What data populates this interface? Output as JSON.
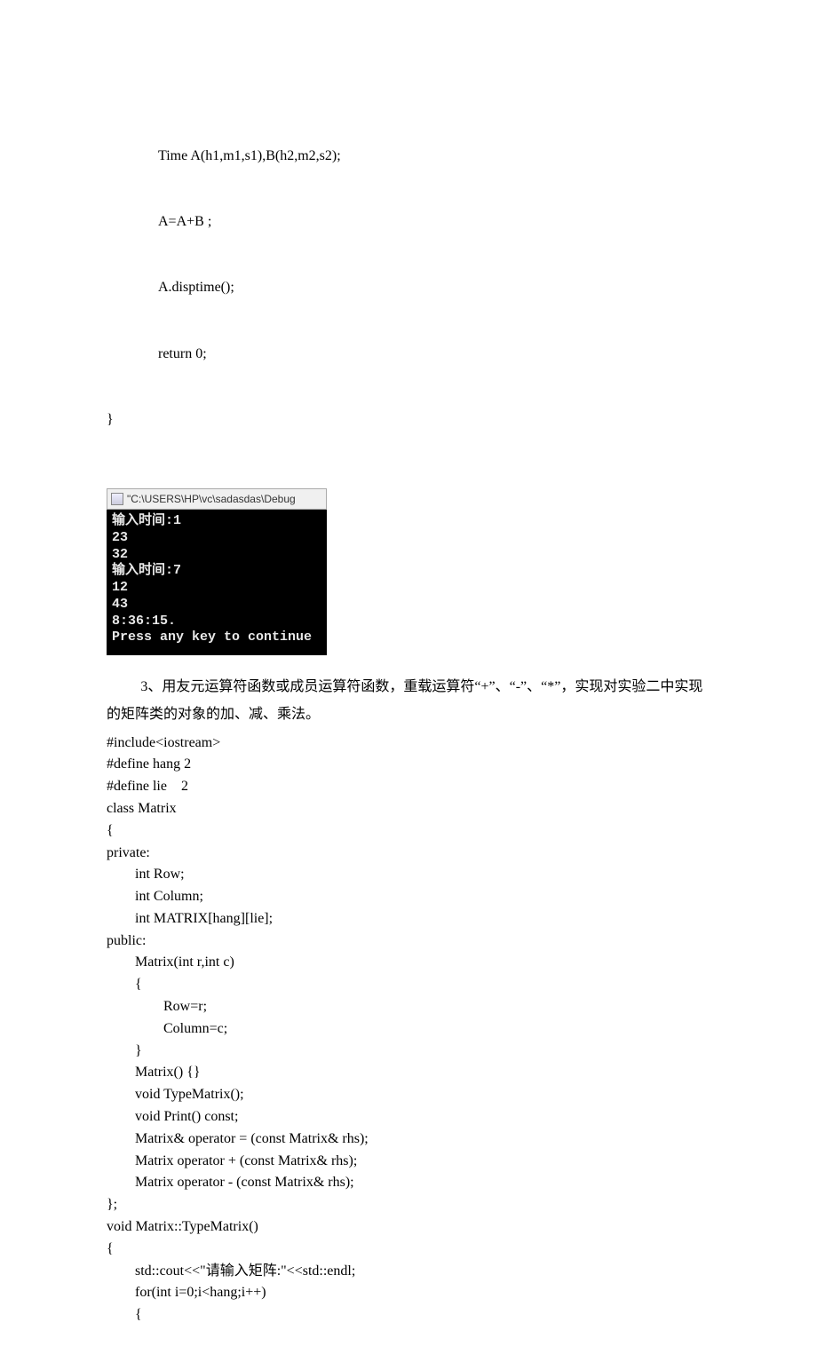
{
  "code_top": {
    "l1": "Time A(h1,m1,s1),B(h2,m2,s2);",
    "l2": "A=A+B ;",
    "l3": "A.disptime();",
    "l4": "return 0;",
    "l5": "}"
  },
  "console": {
    "title_prefix": "\"C:\\USERS\\HP\\vc\\sadasdas\\Debug",
    "line1": "输入时间:1",
    "line2": "23",
    "line3": "32",
    "line4": "输入时间:7",
    "line5": "12",
    "line6": "43",
    "line7": "8:36:15.",
    "line8": "Press any key to continue"
  },
  "paragraph": "3、用友元运算符函数或成员运算符函数，重载运算符“+”、“-”、“*”，实现对实验二中实现的矩阵类的对象的加、减、乘法。",
  "code_main": "#include<iostream>\n#define hang 2\n#define lie    2\nclass Matrix\n{\nprivate:\n        int Row;\n        int Column;\n        int MATRIX[hang][lie];\npublic:\n        Matrix(int r,int c)\n        {\n                Row=r;\n                Column=c;\n        }\n        Matrix() {}\n        void TypeMatrix();\n        void Print() const;\n        Matrix& operator = (const Matrix& rhs);\n        Matrix operator + (const Matrix& rhs);\n        Matrix operator - (const Matrix& rhs);\n};\nvoid Matrix::TypeMatrix()\n{\n        std::cout<<\"请输入矩阵:\"<<std::endl;\n        for(int i=0;i<hang;i++)\n        {"
}
